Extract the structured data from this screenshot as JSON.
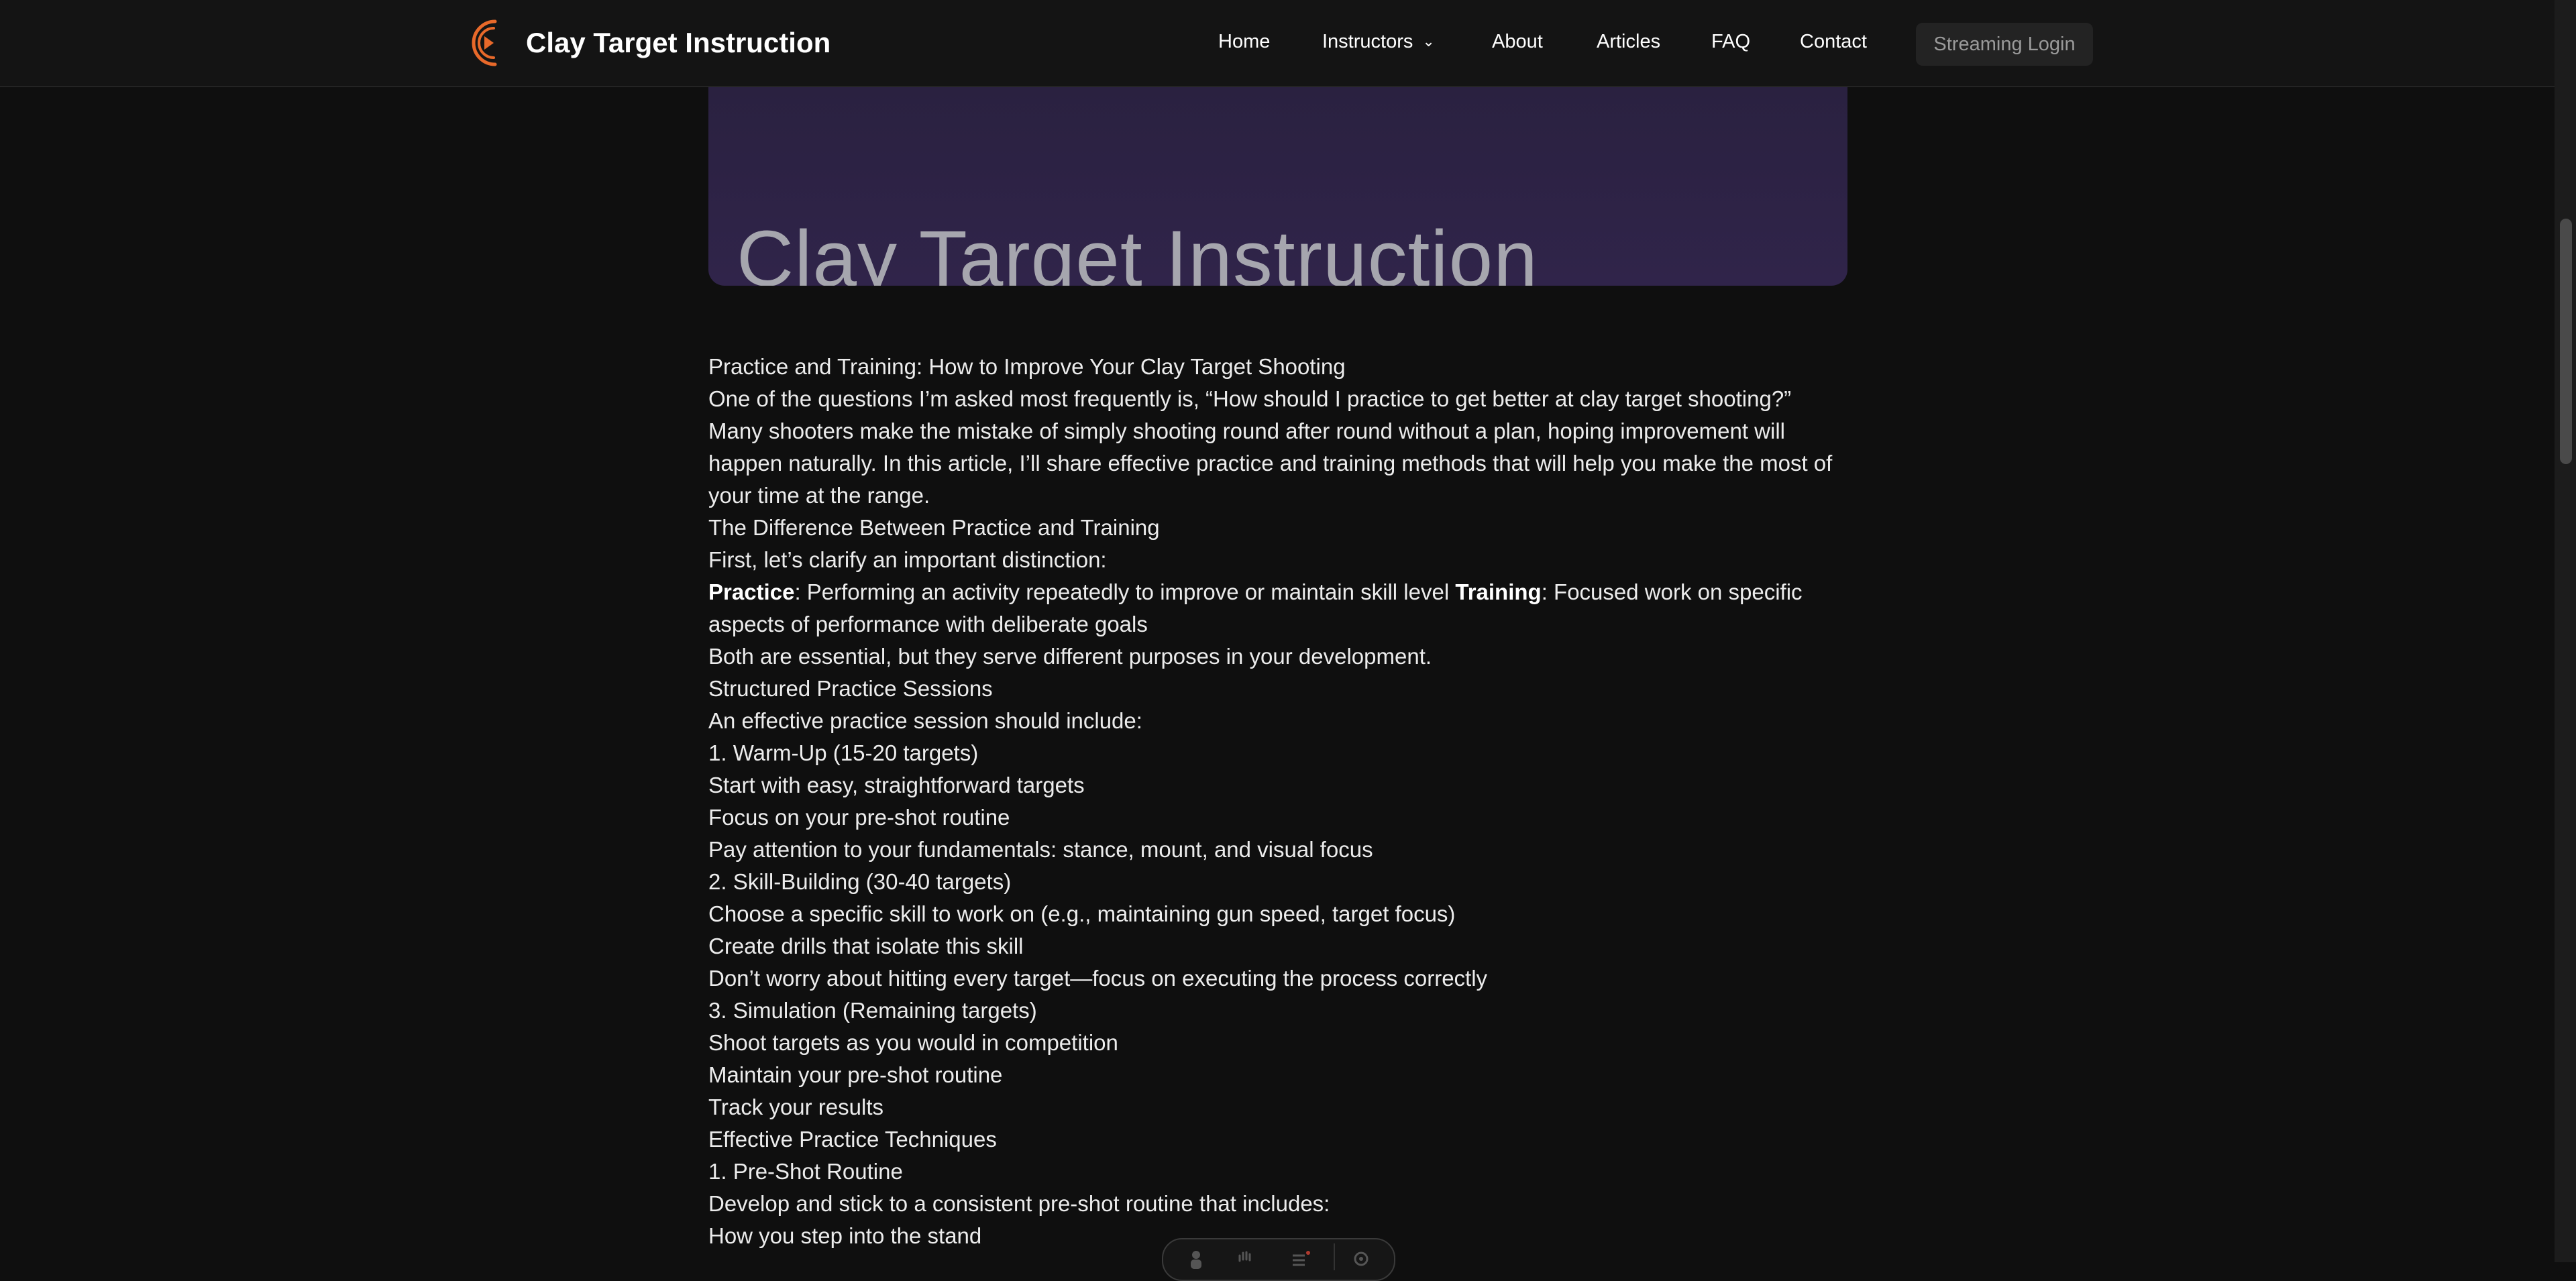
{
  "header": {
    "brand": "Clay Target Instruction",
    "nav": [
      {
        "label": "Home"
      },
      {
        "label": "Instructors"
      },
      {
        "label": "About"
      },
      {
        "label": "Articles"
      },
      {
        "label": "FAQ"
      },
      {
        "label": "Contact"
      }
    ],
    "login_label": "Streaming Login",
    "logo_icon": "play-swoosh-logo-icon",
    "accent": "#e8692a"
  },
  "hero": {
    "title": "Clay Target Instruction",
    "background": "#2d2245"
  },
  "article": {
    "title": "Practice and Training: How to Improve Your Clay Target Shooting",
    "intro": "One of the questions I’m asked most frequently is, “How should I practice to get better at clay target shooting?” Many shooters make the mistake of simply shooting round after round without a plan, hoping improvement will happen naturally. In this article, I’ll share effective practice and training methods that will help you make the most of your time at the range.",
    "h_difference": "The Difference Between Practice and Training",
    "clarify": "First, let’s clarify an important distinction:",
    "practice_term": "Practice",
    "practice_def": ": Performing an activity repeatedly to improve or maintain skill level ",
    "training_term": "Training",
    "training_def": ": Focused work on specific aspects of performance with deliberate goals",
    "both": "Both are essential, but they serve different purposes in your development.",
    "h_structured": "Structured Practice Sessions",
    "session_intro": "An effective practice session should include:",
    "warmup": "1. Warm-Up (15-20 targets)",
    "warmup_1": "Start with easy, straightforward targets",
    "warmup_2": "Focus on your pre-shot routine",
    "warmup_3": "Pay attention to your fundamentals: stance, mount, and visual focus",
    "skill": "2. Skill-Building (30-40 targets)",
    "skill_1": "Choose a specific skill to work on (e.g., maintaining gun speed, target focus)",
    "skill_2": "Create drills that isolate this skill",
    "skill_3": "Don’t worry about hitting every target—focus on executing the process correctly",
    "sim": "3. Simulation (Remaining targets)",
    "sim_1": "Shoot targets as you would in competition",
    "sim_2": "Maintain your pre-shot routine",
    "sim_3": "Track your results",
    "h_techniques": "Effective Practice Techniques",
    "routine": "1. Pre-Shot Routine",
    "routine_intro": "Develop and stick to a consistent pre-shot routine that includes:",
    "routine_1": "How you step into the stand"
  },
  "toolbar": {
    "icons": [
      "person-icon",
      "hand-icon",
      "list-icon",
      "gear-icon"
    ]
  },
  "colors": {
    "background": "#0f0f0f",
    "header": "#141414",
    "text": "#e6e6e6"
  }
}
